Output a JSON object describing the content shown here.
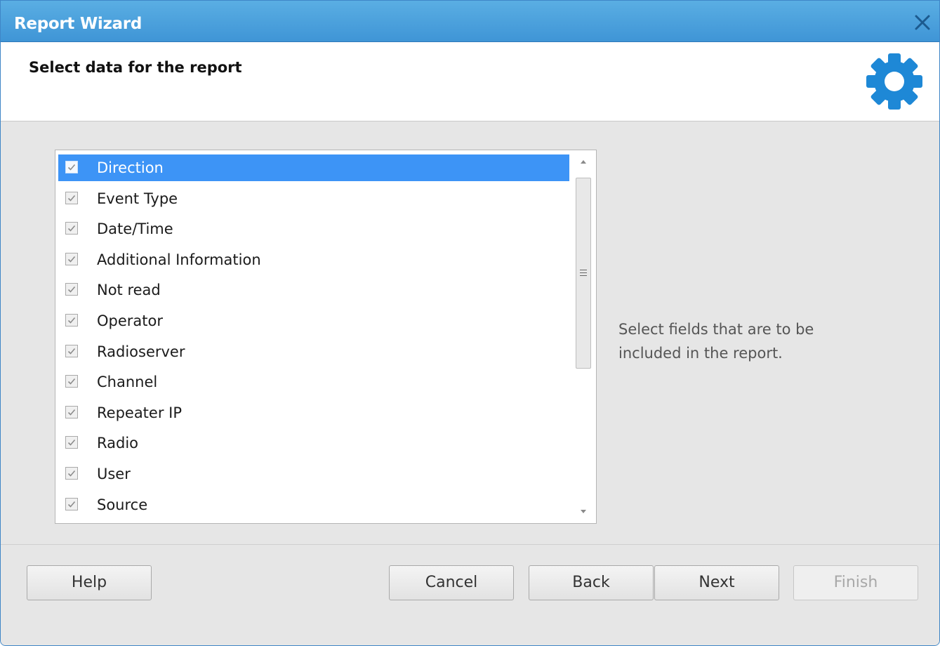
{
  "window": {
    "title": "Report Wizard",
    "close_icon": "close-icon",
    "accent": "#3f95d6"
  },
  "header": {
    "heading": "Select data for the report",
    "icon": "gear-icon",
    "icon_color": "#1e88d6"
  },
  "fields": {
    "items": [
      {
        "label": "Direction",
        "checked": true,
        "selected": true
      },
      {
        "label": "Event Type",
        "checked": true
      },
      {
        "label": "Date/Time",
        "checked": true
      },
      {
        "label": "Additional Information",
        "checked": true
      },
      {
        "label": "Not read",
        "checked": true
      },
      {
        "label": "Operator",
        "checked": true
      },
      {
        "label": "Radioserver",
        "checked": true
      },
      {
        "label": "Channel",
        "checked": true
      },
      {
        "label": "Repeater IP",
        "checked": true
      },
      {
        "label": "Radio",
        "checked": true
      },
      {
        "label": "User",
        "checked": true
      },
      {
        "label": "Source",
        "checked": true
      }
    ],
    "selection_color": "#3d94f6"
  },
  "hint": "Select fields that are to be included in the report.",
  "buttons": {
    "help": "Help",
    "cancel": "Cancel",
    "back": "Back",
    "next": "Next",
    "finish": "Finish"
  }
}
